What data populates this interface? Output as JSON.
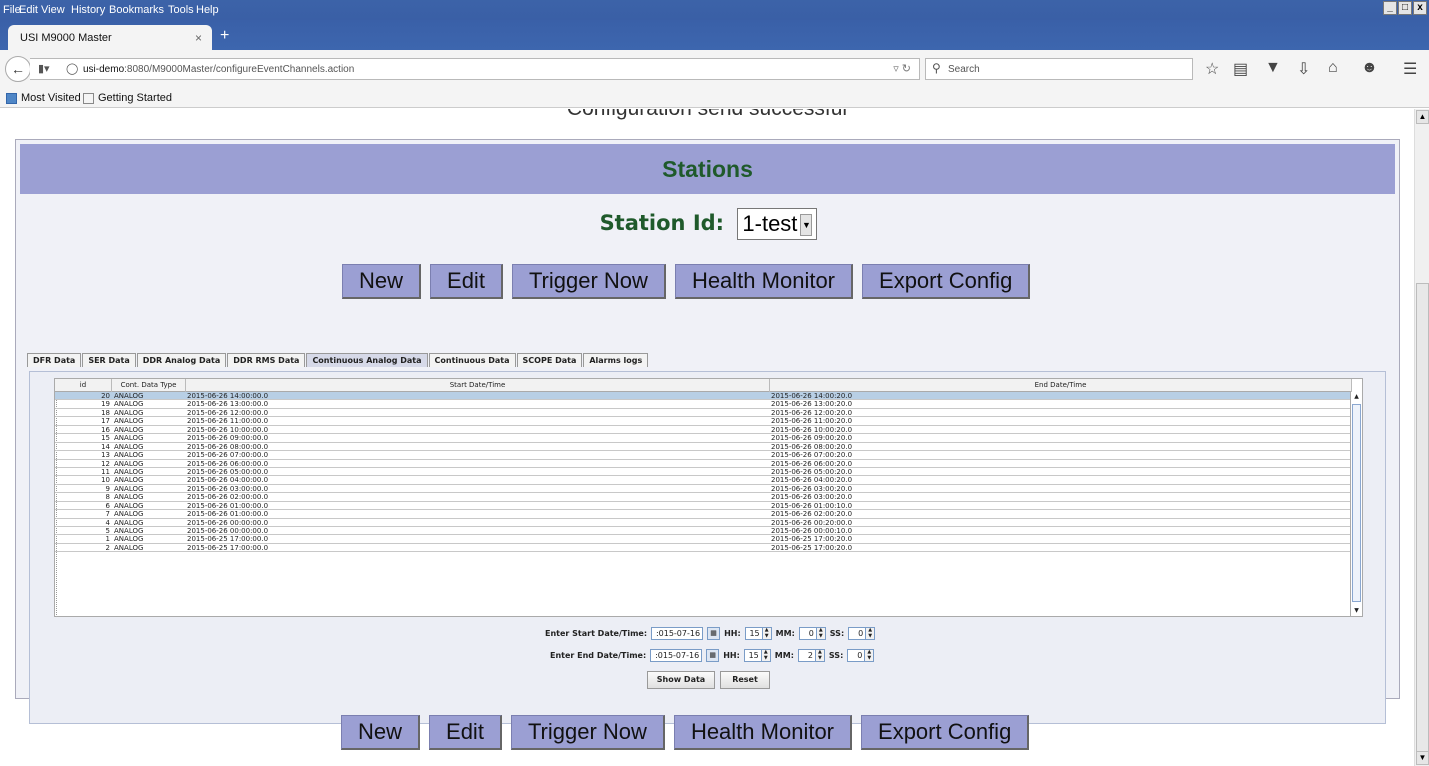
{
  "menu": [
    "File",
    "Edit",
    "View",
    "History",
    "Bookmarks",
    "Tools",
    "Help"
  ],
  "window_controls": [
    "_",
    "□",
    "x"
  ],
  "tab": {
    "title": "USI M9000 Master",
    "close": "×",
    "new": "+"
  },
  "url": {
    "host": "usi-demo",
    "rest": ":8080/M9000Master/configureEventChannels.action"
  },
  "search": {
    "placeholder": "Search"
  },
  "bookmarks": [
    "Most Visited",
    "Getting Started"
  ],
  "page": {
    "cut_message": "Configuration send successful",
    "header": "Stations",
    "station_label": "Station Id:",
    "station_value": "1-test",
    "buttons": [
      "New",
      "Edit",
      "Trigger Now",
      "Health Monitor",
      "Export Config"
    ],
    "tabs": [
      "DFR Data",
      "SER Data",
      "DDR Analog Data",
      "DDR RMS Data",
      "Continuous Analog Data",
      "Continuous Data",
      "SCOPE Data",
      "Alarms logs"
    ],
    "active_tab": "Continuous Analog Data",
    "table": {
      "columns": [
        "id",
        "Cont. Data Type",
        "Start Date/Time",
        "End Date/Time"
      ],
      "rows": [
        [
          "20",
          "ANALOG",
          "2015-06-26 14:00:00.0",
          "2015-06-26 14:00:20.0"
        ],
        [
          "19",
          "ANALOG",
          "2015-06-26 13:00:00.0",
          "2015-06-26 13:00:20.0"
        ],
        [
          "18",
          "ANALOG",
          "2015-06-26 12:00:00.0",
          "2015-06-26 12:00:20.0"
        ],
        [
          "17",
          "ANALOG",
          "2015-06-26 11:00:00.0",
          "2015-06-26 11:00:20.0"
        ],
        [
          "16",
          "ANALOG",
          "2015-06-26 10:00:00.0",
          "2015-06-26 10:00:20.0"
        ],
        [
          "15",
          "ANALOG",
          "2015-06-26 09:00:00.0",
          "2015-06-26 09:00:20.0"
        ],
        [
          "14",
          "ANALOG",
          "2015-06-26 08:00:00.0",
          "2015-06-26 08:00:20.0"
        ],
        [
          "13",
          "ANALOG",
          "2015-06-26 07:00:00.0",
          "2015-06-26 07:00:20.0"
        ],
        [
          "12",
          "ANALOG",
          "2015-06-26 06:00:00.0",
          "2015-06-26 06:00:20.0"
        ],
        [
          "11",
          "ANALOG",
          "2015-06-26 05:00:00.0",
          "2015-06-26 05:00:20.0"
        ],
        [
          "10",
          "ANALOG",
          "2015-06-26 04:00:00.0",
          "2015-06-26 04:00:20.0"
        ],
        [
          "9",
          "ANALOG",
          "2015-06-26 03:00:00.0",
          "2015-06-26 03:00:20.0"
        ],
        [
          "8",
          "ANALOG",
          "2015-06-26 02:00:00.0",
          "2015-06-26 03:00:20.0"
        ],
        [
          "6",
          "ANALOG",
          "2015-06-26 01:00:00.0",
          "2015-06-26 01:00:10.0"
        ],
        [
          "7",
          "ANALOG",
          "2015-06-26 01:00:00.0",
          "2015-06-26 02:00:20.0"
        ],
        [
          "4",
          "ANALOG",
          "2015-06-26 00:00:00.0",
          "2015-06-26 00:20:00.0"
        ],
        [
          "5",
          "ANALOG",
          "2015-06-26 00:00:00.0",
          "2015-06-26 00:00:10.0"
        ],
        [
          "1",
          "ANALOG",
          "2015-06-25 17:00:00.0",
          "2015-06-25 17:00:20.0"
        ],
        [
          "2",
          "ANALOG",
          "2015-06-25 17:00:00.0",
          "2015-06-25 17:00:20.0"
        ]
      ]
    },
    "start": {
      "label": "Enter Start Date/Time:",
      "date": ":015-07-16",
      "hh_label": "HH:",
      "hh": "15",
      "mm_label": "MM:",
      "mm": "0",
      "ss_label": "SS:",
      "ss": "0"
    },
    "end": {
      "label": "Enter End Date/Time:",
      "date": ":015-07-16",
      "hh_label": "HH:",
      "hh": "15",
      "mm_label": "MM:",
      "mm": "2",
      "ss_label": "SS:",
      "ss": "0"
    },
    "show_data": "Show Data",
    "reset": "Reset"
  },
  "colors": {
    "header_bg": "#9b9fd3",
    "header_text": "#1f5a2b",
    "chrome_blue": "#3a60a8",
    "selected_row": "#b8cfe5"
  }
}
